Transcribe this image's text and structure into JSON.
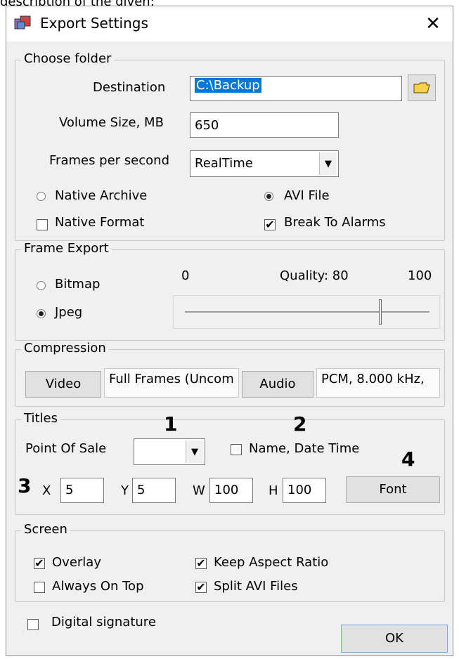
{
  "caption_text": "description of the given:",
  "window": {
    "title": "Export Settings",
    "close_glyph": "✕"
  },
  "choose_folder": {
    "label": "Choose folder",
    "destination_label": "Destination",
    "destination_value": "C:\\Backup",
    "volume_label": "Volume Size, MB",
    "volume_value": "650",
    "fps_label": "Frames per second",
    "fps_value": "RealTime",
    "native_archive": "Native Archive",
    "avi_file": "AVI File",
    "native_format": "Native Format",
    "break_alarms": "Break To Alarms",
    "selected_mode": "AVI File",
    "native_format_checked": false,
    "break_alarms_checked": true
  },
  "frame_export": {
    "label": "Frame Export",
    "bitmap": "Bitmap",
    "jpeg": "Jpeg",
    "selected": "Jpeg",
    "min_label": "0",
    "max_label": "100",
    "quality_label": "Quality: 80",
    "quality_value": 80,
    "quality_min": 0,
    "quality_max": 100
  },
  "compression": {
    "label": "Compression",
    "video_button": "Video",
    "video_value": "Full Frames (Uncom",
    "audio_button": "Audio",
    "audio_value": "PCM, 8.000 kHz, "
  },
  "titles": {
    "label": "Titles",
    "pos_label": "Point Of Sale",
    "pos_value": "",
    "name_date_label": "Name, Date Time",
    "name_date_checked": false,
    "x_label": "X",
    "x_value": "5",
    "y_label": "Y",
    "y_value": "5",
    "w_label": "W",
    "w_value": "100",
    "h_label": "H",
    "h_value": "100",
    "font_button": "Font"
  },
  "annotations": {
    "a1": "1",
    "a2": "2",
    "a3": "3",
    "a4": "4"
  },
  "screen": {
    "label": "Screen",
    "overlay": "Overlay",
    "overlay_checked": true,
    "always_on_top": "Always On Top",
    "always_on_top_checked": false,
    "keep_aspect": "Keep Aspect Ratio",
    "keep_aspect_checked": true,
    "split_avi": "Split AVI Files",
    "split_avi_checked": true
  },
  "digital_signature": {
    "label": "Digital signature",
    "checked": false
  },
  "ok_button": "OK",
  "check_glyph": "✔",
  "combo_arrow_glyph": "▼"
}
